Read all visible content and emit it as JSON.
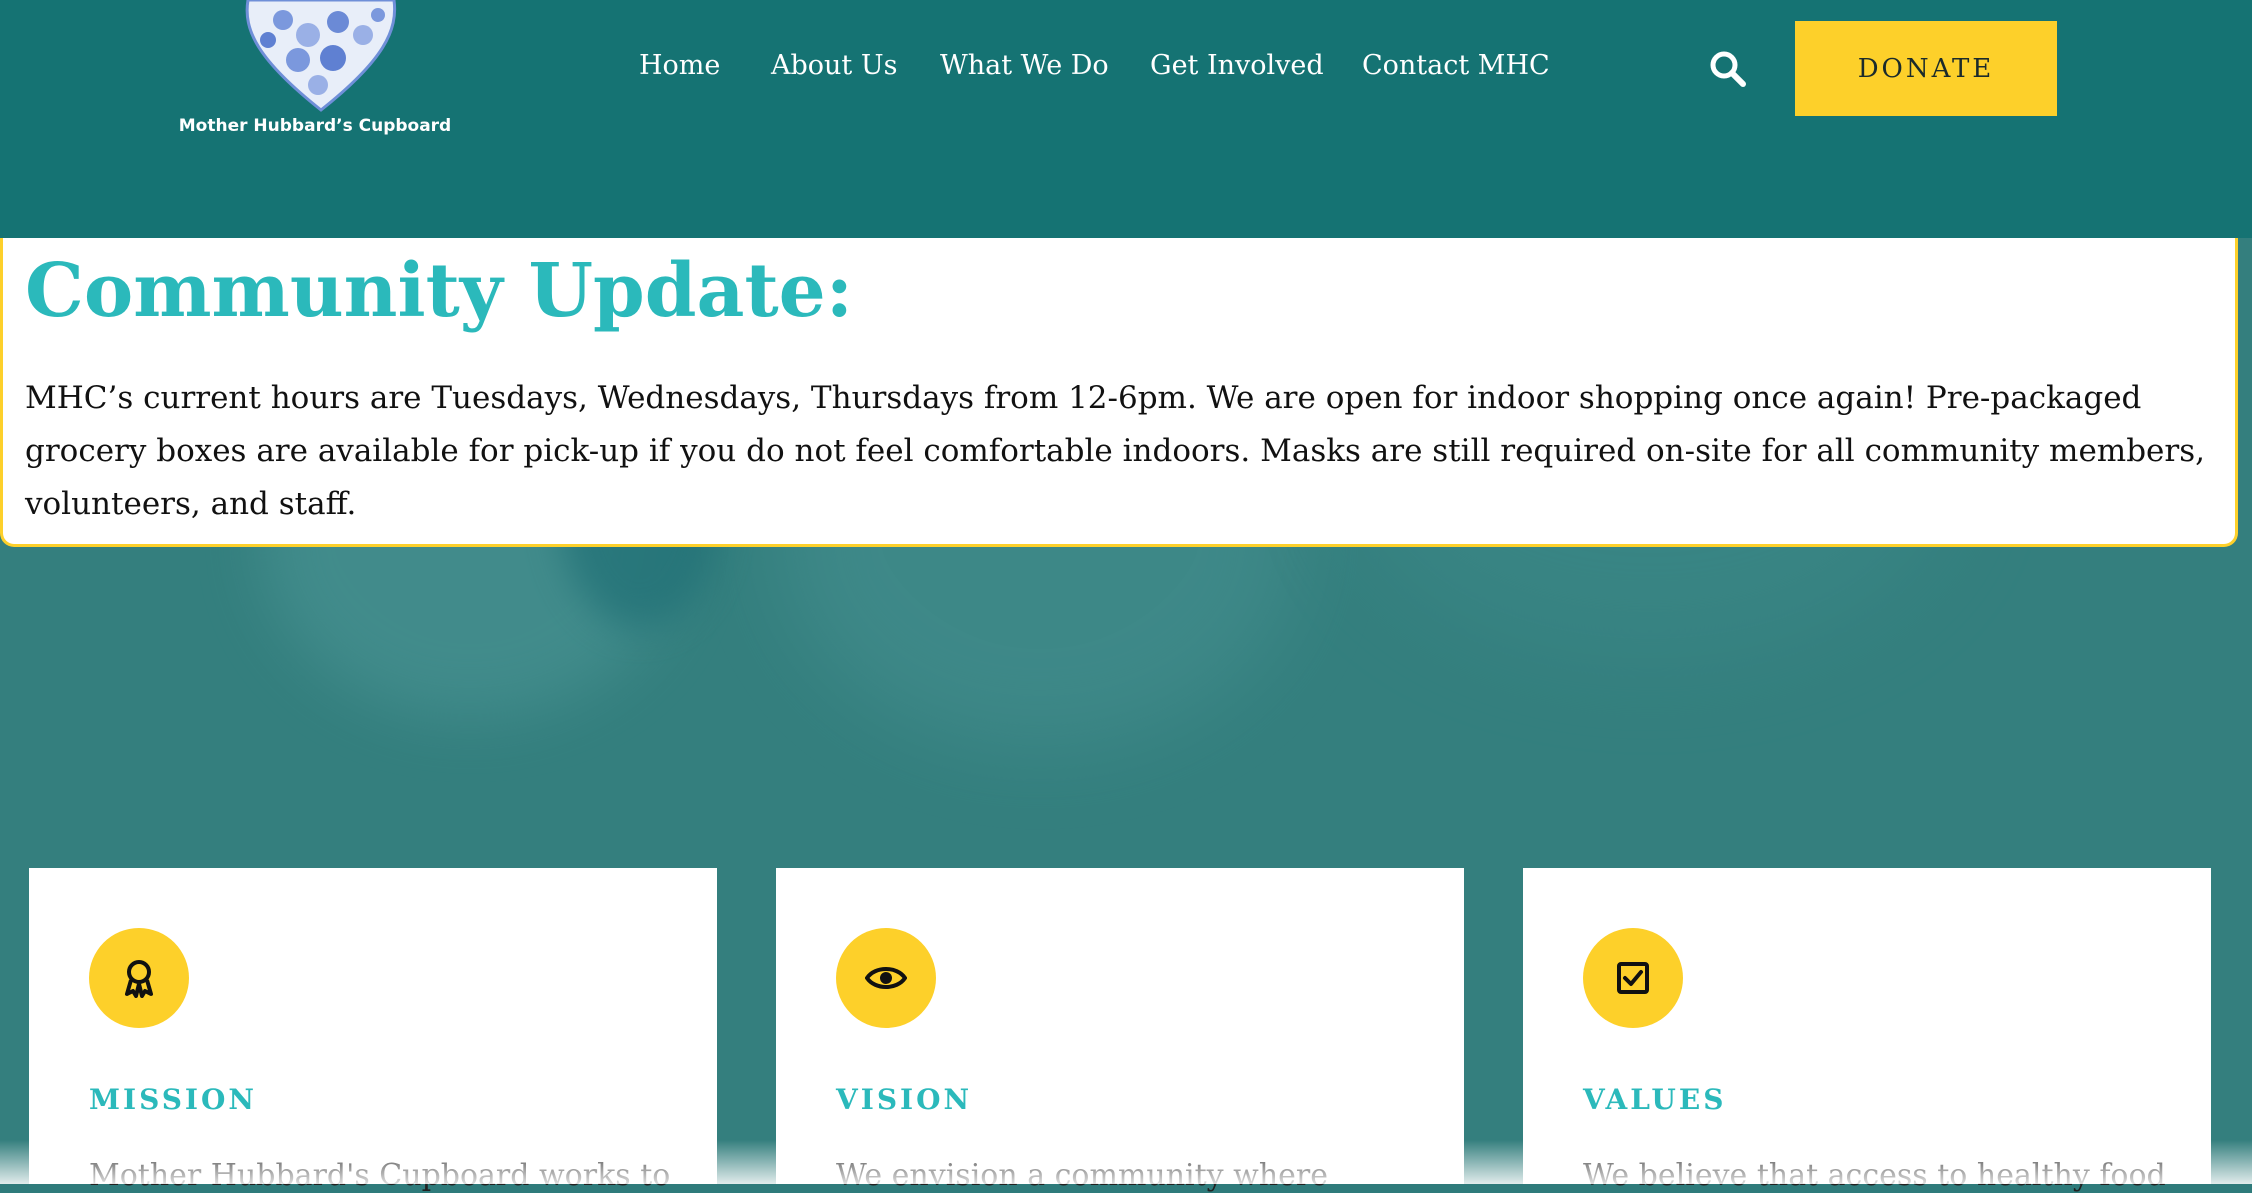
{
  "header": {
    "logo_text": "Mother Hubbard’s Cupboard",
    "nav": [
      "Home",
      "About Us",
      "What We Do",
      "Get Involved",
      "Contact MHC"
    ],
    "donate_label": "DONATE"
  },
  "update": {
    "title": "Community Update:",
    "body": "MHC’s current hours are Tuesdays, Wednesdays, Thursdays from 12-6pm. We are open for indoor shopping once again! Pre-packaged grocery boxes are available for pick-up if you do not feel comfortable indoors. Masks are still required on-site for all community members, volunteers, and staff."
  },
  "cards": [
    {
      "icon": "award-ribbon-icon",
      "title": "MISSION",
      "text": "Mother Hubbard's Cupboard works to"
    },
    {
      "icon": "eye-icon",
      "title": "VISION",
      "text": "We envision a community where"
    },
    {
      "icon": "checkbox-icon",
      "title": "VALUES",
      "text": "We believe that access to healthy food"
    }
  ],
  "colors": {
    "header_bg": "#157373",
    "accent_yellow": "#fdd02a",
    "heading_teal": "#2bb9bb",
    "hero_bg": "#347f7e"
  }
}
